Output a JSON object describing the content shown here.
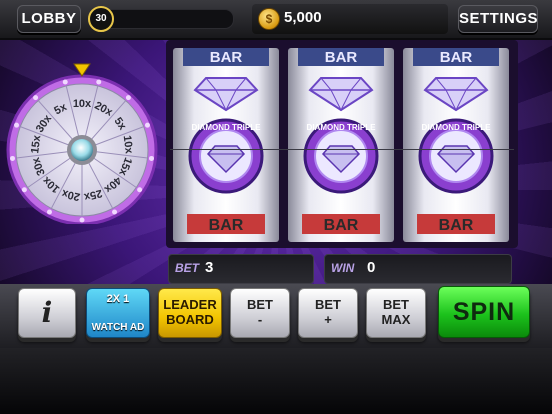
{
  "topbar": {
    "lobby_label": "LOBBY",
    "level": "30",
    "coins": "5,000",
    "settings_label": "SETTINGS"
  },
  "wheel": {
    "segments": [
      "10x",
      "20x",
      "5x",
      "10x",
      "15x",
      "40x",
      "25x",
      "20x",
      "10x",
      "30x",
      "15x",
      "30x",
      "5x"
    ]
  },
  "reels": [
    {
      "top_symbol": "BAR",
      "middle_symbol": "DIAMOND TRIPLE",
      "bottom_symbol": "BAR"
    },
    {
      "top_symbol": "BAR",
      "middle_symbol": "DIAMOND TRIPLE",
      "bottom_symbol": "BAR"
    },
    {
      "top_symbol": "BAR",
      "middle_symbol": "DIAMOND TRIPLE",
      "bottom_symbol": "BAR"
    }
  ],
  "bet": {
    "label": "BET",
    "value": "3"
  },
  "win": {
    "label": "WIN",
    "value": "0"
  },
  "controls": {
    "info_label": "i",
    "watch_ad": {
      "multiplier": "2X 1",
      "label": "WATCH AD"
    },
    "leaderboard": {
      "line1": "LEADER",
      "line2": "BOARD"
    },
    "bet_minus": {
      "line1": "BET",
      "line2": "-"
    },
    "bet_plus": {
      "line1": "BET",
      "line2": "+"
    },
    "bet_max": {
      "line1": "BET",
      "line2": "MAX"
    },
    "spin_label": "SPIN"
  },
  "colors": {
    "accent_purple": "#6a32b8",
    "spin_green": "#1cc21c",
    "leaderboard_yellow": "#f2c400",
    "watch_ad_blue": "#1f86c8"
  }
}
